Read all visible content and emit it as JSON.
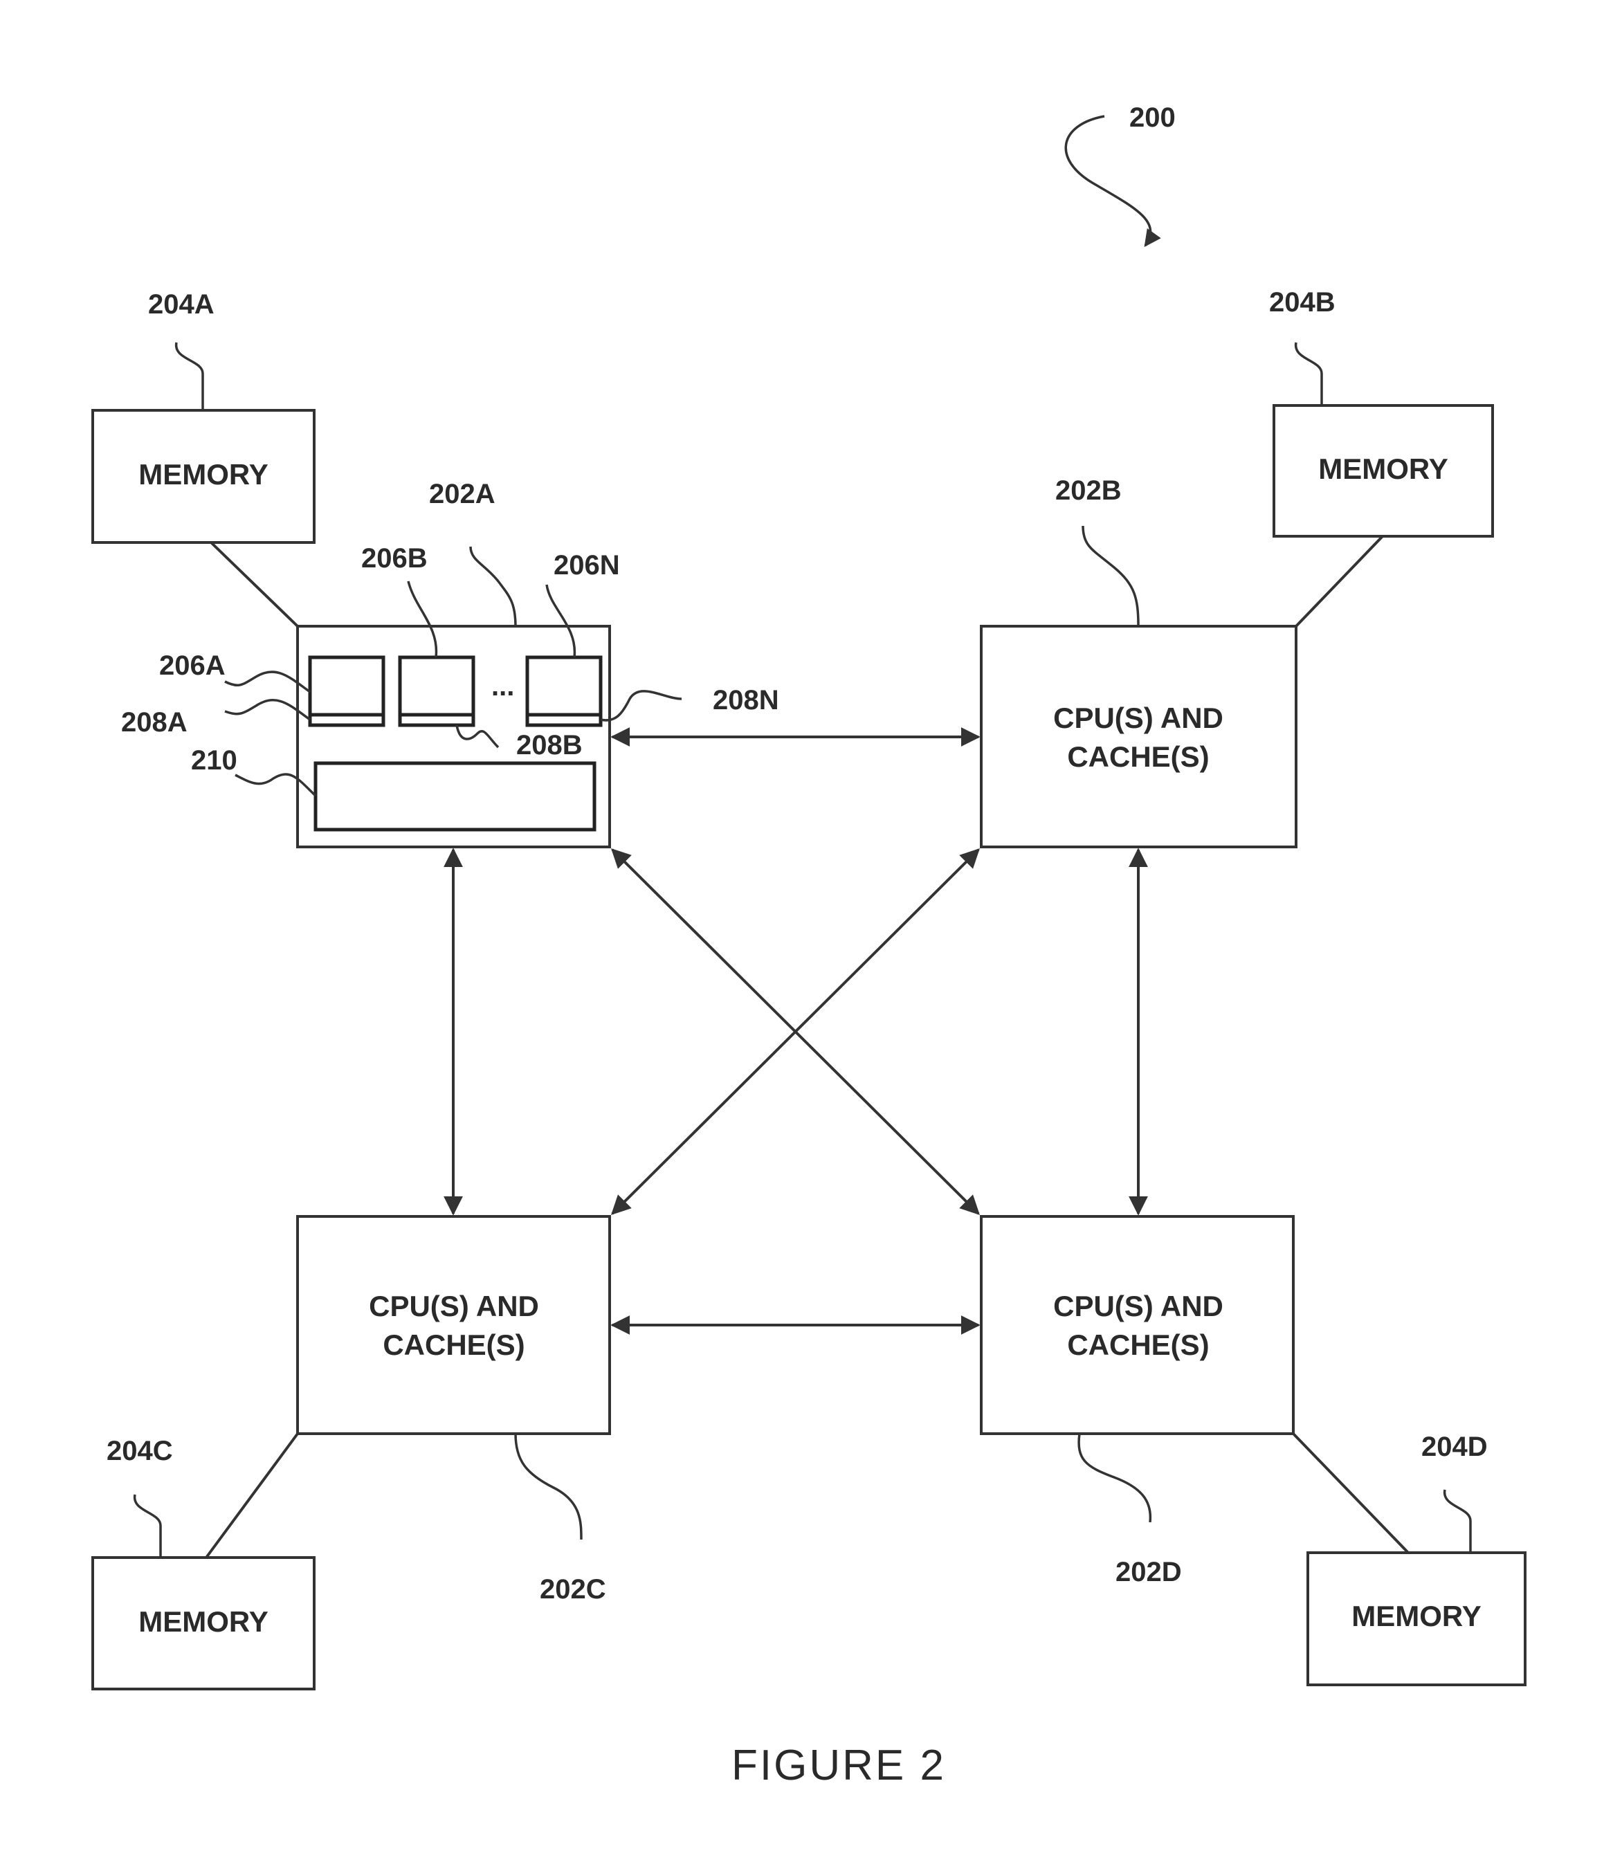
{
  "figure": {
    "caption": "FIGURE 2",
    "ref": "200"
  },
  "nodes": {
    "n202A": {
      "ref": "202A",
      "lines": []
    },
    "n202B": {
      "ref": "202B",
      "lines": [
        "CPU(S) AND",
        "CACHE(S)"
      ]
    },
    "n202C": {
      "ref": "202C",
      "lines": [
        "CPU(S) AND",
        "CACHE(S)"
      ]
    },
    "n202D": {
      "ref": "202D",
      "lines": [
        "CPU(S) AND",
        "CACHE(S)"
      ]
    },
    "m204A": {
      "ref": "204A",
      "label": "MEMORY"
    },
    "m204B": {
      "ref": "204B",
      "label": "MEMORY"
    },
    "m204C": {
      "ref": "204C",
      "label": "MEMORY"
    },
    "m204D": {
      "ref": "204D",
      "label": "MEMORY"
    }
  },
  "subcomponents": {
    "s206A": "206A",
    "s206B": "206B",
    "s206N": "206N",
    "s208A": "208A",
    "s208B": "208B",
    "s208N": "208N",
    "s210": "210",
    "ellipsis": "..."
  },
  "edges": [
    {
      "from": "202A",
      "to": "202B",
      "type": "bidirectional"
    },
    {
      "from": "202A",
      "to": "202C",
      "type": "bidirectional"
    },
    {
      "from": "202A",
      "to": "202D",
      "type": "bidirectional"
    },
    {
      "from": "202B",
      "to": "202C",
      "type": "bidirectional"
    },
    {
      "from": "202B",
      "to": "202D",
      "type": "bidirectional"
    },
    {
      "from": "202C",
      "to": "202D",
      "type": "bidirectional"
    },
    {
      "from": "202A",
      "to": "204A",
      "type": "line"
    },
    {
      "from": "202B",
      "to": "204B",
      "type": "line"
    },
    {
      "from": "202C",
      "to": "204C",
      "type": "line"
    },
    {
      "from": "202D",
      "to": "204D",
      "type": "line"
    }
  ]
}
